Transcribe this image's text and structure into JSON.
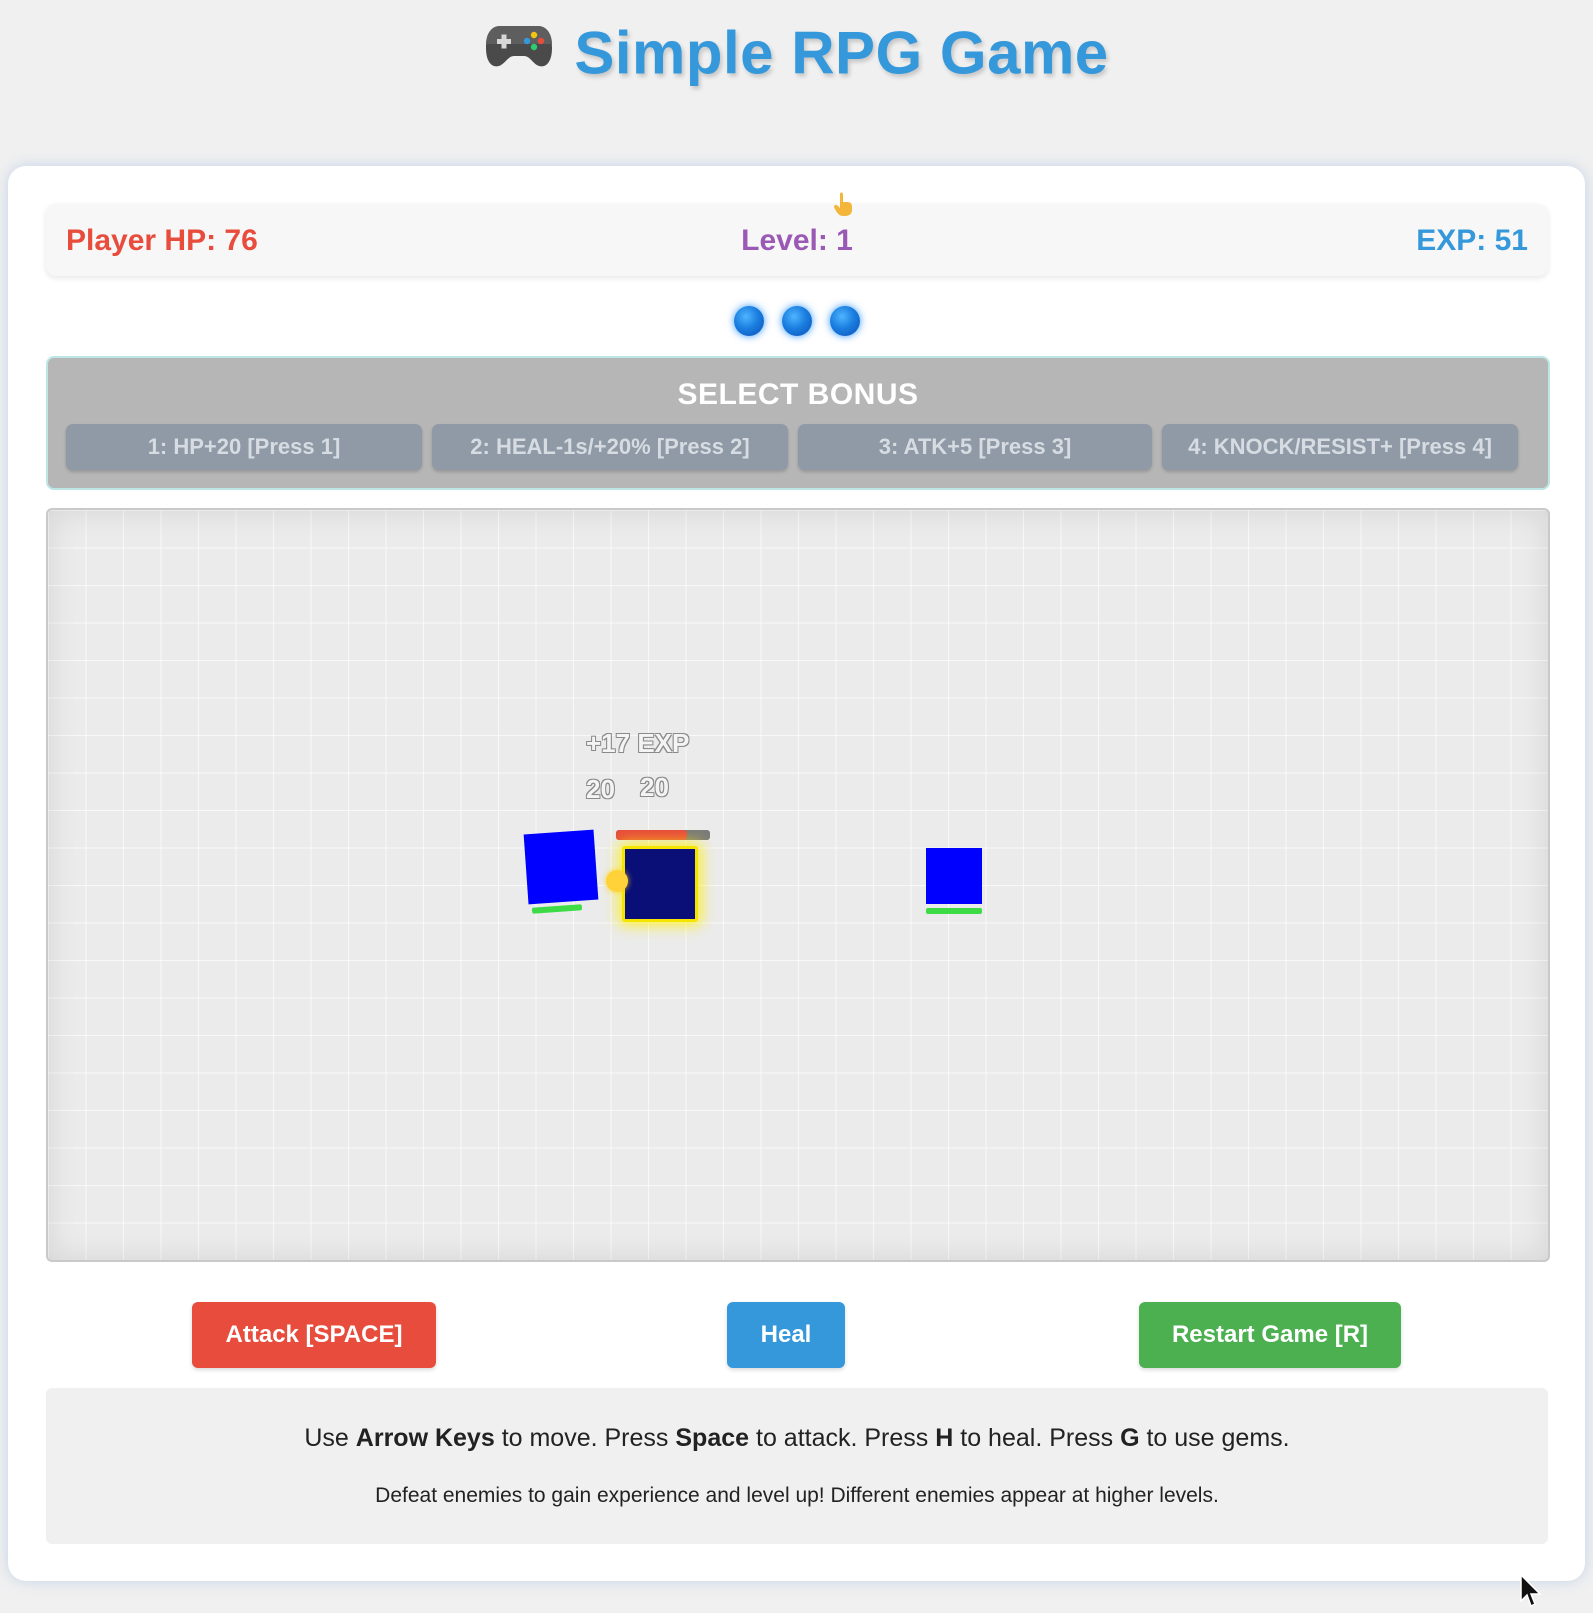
{
  "header": {
    "icon": "gamepad-icon",
    "title": "Simple RPG Game"
  },
  "stats": {
    "hp_label": "Player HP: 76",
    "level_label": "Level: 1",
    "exp_label": "EXP: 51"
  },
  "gems": {
    "count": 3,
    "icon": "gem-icon",
    "color": "#1b7fe0"
  },
  "bonus": {
    "title": "SELECT BONUS",
    "options": [
      "1: HP+20 [Press 1]",
      "2: HEAL-1s/+20% [Press 2]",
      "3: ATK+5 [Press 3]",
      "4: KNOCK/RESIST+ [Press 4]"
    ]
  },
  "game": {
    "exp_popup": "+17 EXP",
    "damage_popups": [
      "20",
      "20"
    ],
    "player_hp_fraction": 0.76,
    "enemy_hp_fraction": 1.0,
    "colors": {
      "enemy": "#0000ff",
      "player": "#0a0f78",
      "player_glow": "#f5e400"
    }
  },
  "actions": {
    "attack_label": "Attack [SPACE]",
    "heal_label": "Heal",
    "restart_label": "Restart Game [R]",
    "attack_color": "#e74c3c",
    "heal_color": "#3498db",
    "restart_color": "#4cb050"
  },
  "instructions": {
    "w1": "Use",
    "k1": "Arrow Keys",
    "w2": "to move. Press",
    "k2": "Space",
    "w3": "to attack. Press",
    "k3": "H",
    "w4": "to heal. Press",
    "k4": "G",
    "w5": "to use gems.",
    "sub": "Defeat enemies to gain experience and level up! Different enemies appear at higher levels."
  }
}
